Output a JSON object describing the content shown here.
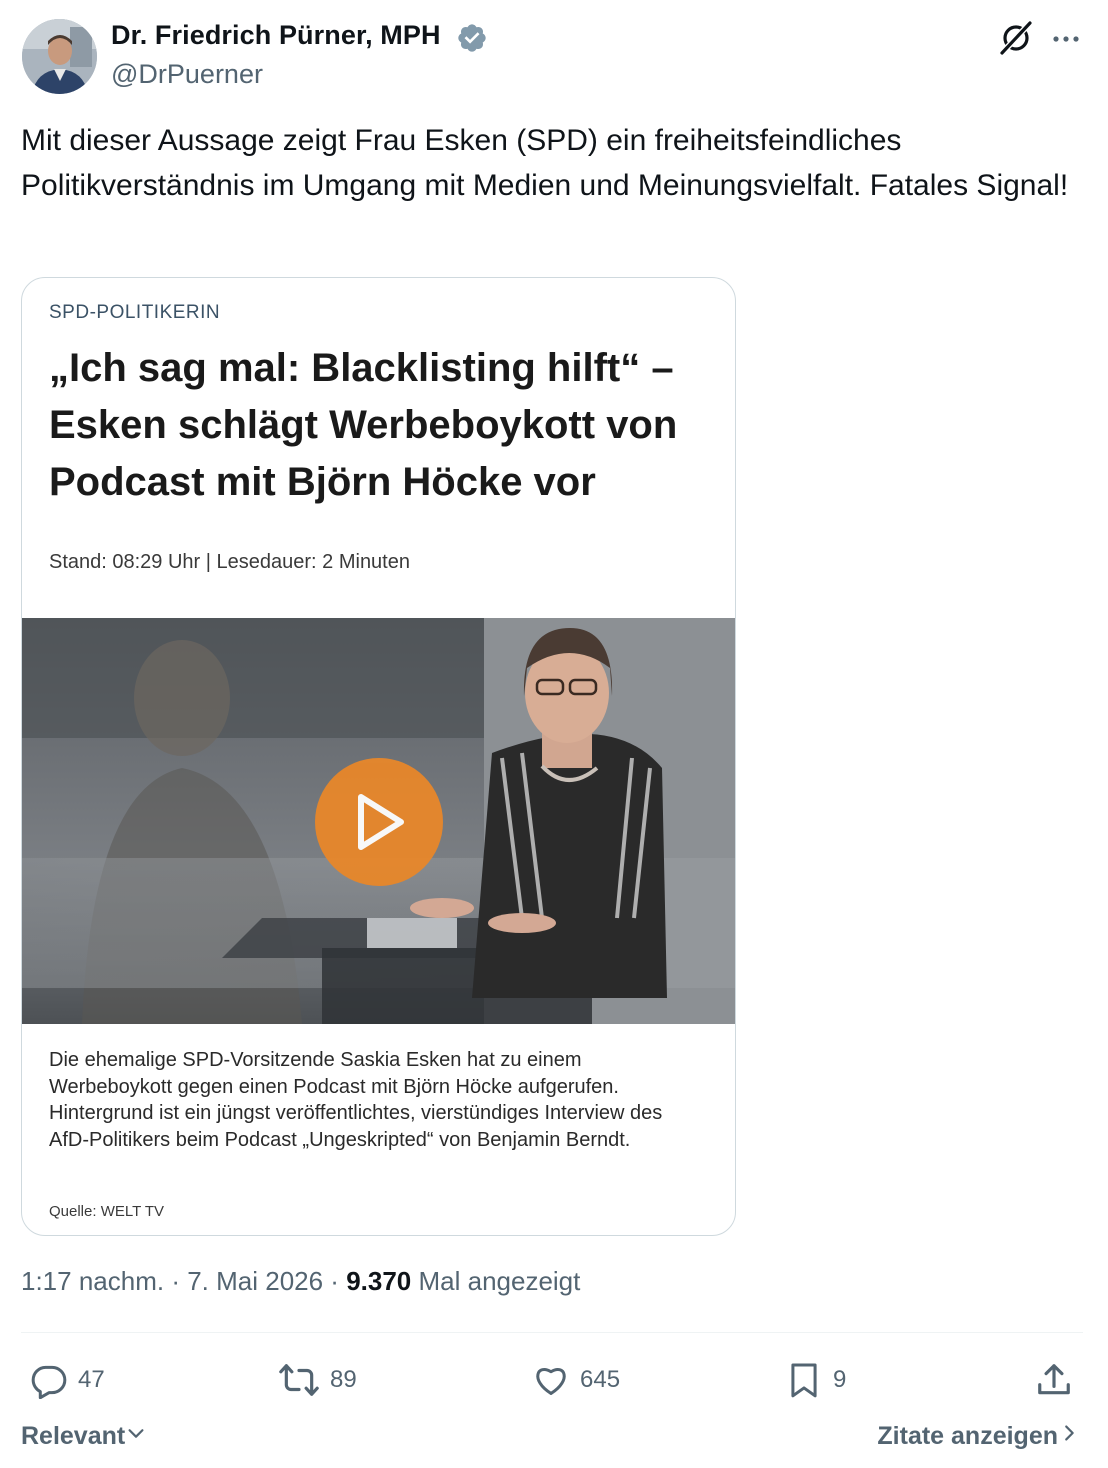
{
  "author": {
    "display_name": "Dr. Friedrich Pürner, MPH",
    "handle": "@DrPuerner",
    "verified": true,
    "verified_color": "#829aab"
  },
  "tweet": {
    "text": "Mit dieser Aussage zeigt Frau Esken (SPD) ein freiheitsfeindliches Politikverständnis im Umgang mit Medien und Meinungsvielfalt. Fatales Signal!"
  },
  "card": {
    "kicker": "SPD-POLITIKERIN",
    "headline": "„Ich sag mal: Blacklisting hilft“ – Esken schlägt Werbeboykott von Podcast mit Björn Höcke vor",
    "meta": "Stand: 08:29 Uhr | Lesedauer: 2 Minuten",
    "summary": "Die ehemalige SPD-Vorsitzende Saskia Esken hat zu einem Werbeboykott gegen einen Podcast mit Björn Höcke aufgerufen. Hintergrund ist ein jüngst veröffentlichtes, vierstündiges Interview des AfD-Politikers beim Podcast „Ungeskripted“ von Benjamin Berndt.",
    "source": "Quelle: WELT TV",
    "play_color": "#e8872a"
  },
  "timestamp": {
    "time": "1:17 nachm.",
    "sep1": " · ",
    "date": "7. Mai 2026",
    "sep2": " · ",
    "views": "9.370",
    "views_label": " Mal angezeigt"
  },
  "actions": {
    "replies": "47",
    "reposts": "89",
    "likes": "645",
    "bookmarks": "9"
  },
  "footer": {
    "sort_label": "Relevant",
    "quotes_label": "Zitate anzeigen"
  },
  "icons": {
    "header_right": [
      "grok-icon",
      "more-icon"
    ],
    "actions": [
      "reply-icon",
      "repost-icon",
      "like-icon",
      "bookmark-icon",
      "share-icon"
    ]
  }
}
